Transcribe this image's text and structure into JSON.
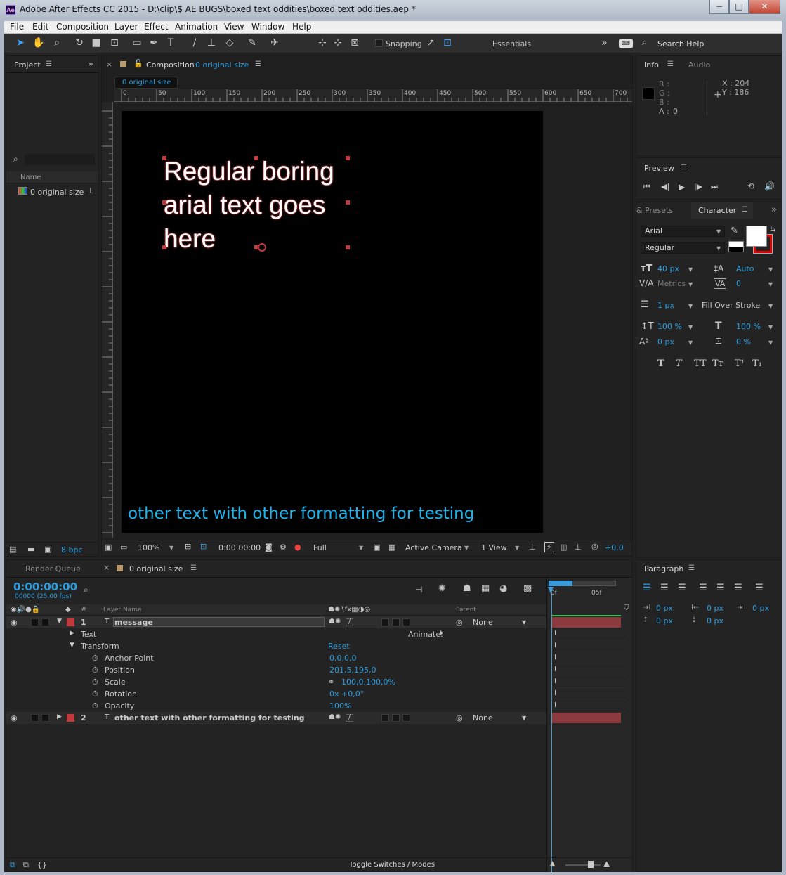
{
  "window": {
    "app_icon": "Ae",
    "title": "Adobe After Effects CC 2015 - D:\\clip\\$ AE BUGS\\boxed text oddities\\boxed text oddities.aep *",
    "minimize": "−",
    "maximize": "□",
    "close": "✕"
  },
  "menu": [
    "File",
    "Edit",
    "Composition",
    "Layer",
    "Effect",
    "Animation",
    "View",
    "Window",
    "Help"
  ],
  "toolbar": {
    "snapping_label": "Snapping",
    "workspace_label": "Essentials",
    "search_placeholder": "Search Help",
    "overflow": "»"
  },
  "project": {
    "tab": "Project",
    "search_placeholder": "",
    "column_name": "Name",
    "items": [
      {
        "name": "0 original size"
      }
    ],
    "bpc_label": "8 bpc"
  },
  "composition_panel": {
    "tab_prefix": "Composition",
    "comp_name": "0 original size",
    "flow_tab": "0 original size",
    "ruler_labels": [
      "0",
      "50",
      "100",
      "150",
      "200",
      "250",
      "300",
      "350",
      "400",
      "450",
      "500",
      "550",
      "600",
      "650",
      "700"
    ],
    "main_text_lines": [
      "Regular boring",
      "arial text goes",
      "here"
    ],
    "bottom_text": "other text with other formatting for testing",
    "footer": {
      "zoom": "100%",
      "timecode": "0:00:00:00",
      "resolution": "Full",
      "camera": "Active Camera",
      "view": "1 View",
      "exposure": "+0,0"
    }
  },
  "info_panel": {
    "tab_info": "Info",
    "tab_audio": "Audio",
    "r_label": "R :",
    "g_label": "G :",
    "b_label": "B :",
    "a_label": "A :",
    "a_value": "0",
    "x_readout": "X : 204",
    "y_readout": "Y : 186"
  },
  "preview_panel": {
    "tab": "Preview"
  },
  "character_panel": {
    "tab_presets": "& Presets",
    "tab_character": "Character",
    "font": "Arial",
    "style": "Regular",
    "font_size": "40 px",
    "leading": "Auto",
    "kerning": "Metrics",
    "tracking": "0",
    "stroke_width": "1 px",
    "stroke_mode": "Fill Over Stroke",
    "vscale": "100 %",
    "hscale": "100 %",
    "baseline": "0 px",
    "tsume": "0 %",
    "format_buttons": [
      "T",
      "T",
      "TT",
      "Tт",
      "T¹",
      "T₁"
    ],
    "fill_color": "#ffffff",
    "stroke_color": "#e00000"
  },
  "paragraph_panel": {
    "tab": "Paragraph",
    "indent_left": "0 px",
    "indent_right": "0 px",
    "indent_first": "0 px",
    "space_before": "0 px",
    "space_after": "0 px"
  },
  "timeline": {
    "tab_render_queue": "Render Queue",
    "tab_comp": "0 original size",
    "timecode": "0:00:00:00",
    "frame_info": "00000 (25.00 fps)",
    "col_num": "#",
    "col_layer_name": "Layer Name",
    "col_parent": "Parent",
    "ruler_0": "0f",
    "ruler_5": "05f",
    "layers": [
      {
        "num": "1",
        "name": "message",
        "parent": "None",
        "color": "#c0393d"
      },
      {
        "num": "2",
        "name": "other text with other formatting for testing",
        "parent": "None",
        "color": "#c0393d"
      }
    ],
    "text_group": "Text",
    "animate_label": "Animate:",
    "transform_group": "Transform",
    "reset_label": "Reset",
    "props": [
      {
        "name": "Anchor Point",
        "value": "0,0,0,0"
      },
      {
        "name": "Position",
        "value": "201,5,195,0"
      },
      {
        "name": "Scale",
        "value": "100,0,100,0%"
      },
      {
        "name": "Rotation",
        "value": "0x +0,0°"
      },
      {
        "name": "Opacity",
        "value": "100%"
      }
    ],
    "toggle_label": "Toggle Switches / Modes"
  }
}
